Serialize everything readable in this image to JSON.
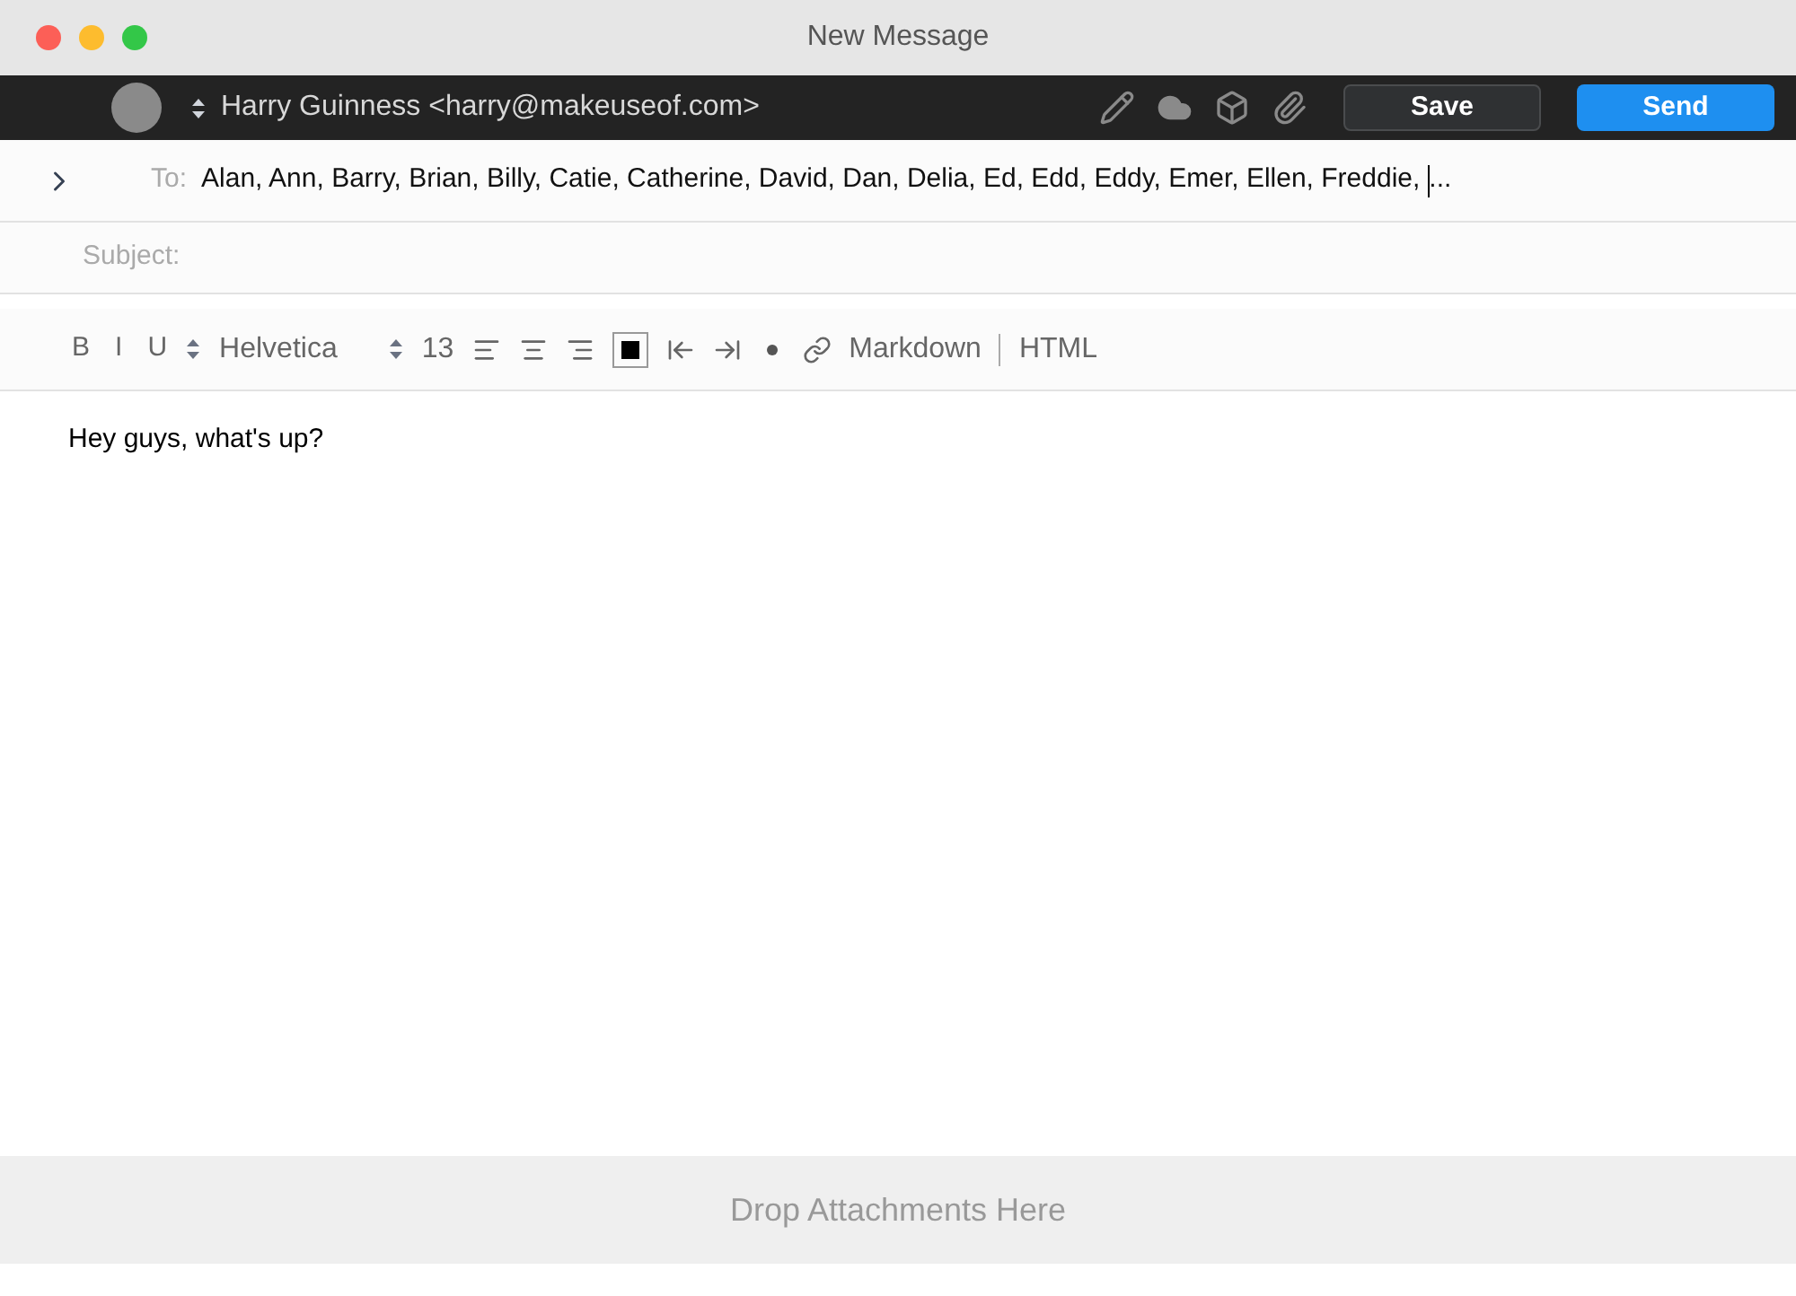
{
  "window": {
    "title": "New Message"
  },
  "toolbar": {
    "sender": "Harry Guinness <harry@makeuseof.com>",
    "buttons": [
      {
        "label": "Save",
        "kind": "secondary"
      },
      {
        "label": "Send",
        "kind": "primary"
      }
    ]
  },
  "to": {
    "label": "To:",
    "value": "Alan, Ann, Barry, Brian, Billy, Catie, Catherine, David, Dan, Delia, Ed, Edd, Eddy, Emer, Ellen, Freddie,",
    "more": "..."
  },
  "subject": {
    "label": "Subject:"
  },
  "format_bar": {
    "bold": "B",
    "italic": "I",
    "underline": "U",
    "font": "Helvetica",
    "size": "13",
    "modes": [
      "Markdown",
      "HTML"
    ]
  },
  "body": "Hey guys, what's up?",
  "footer": "Drop Attachments Here"
}
